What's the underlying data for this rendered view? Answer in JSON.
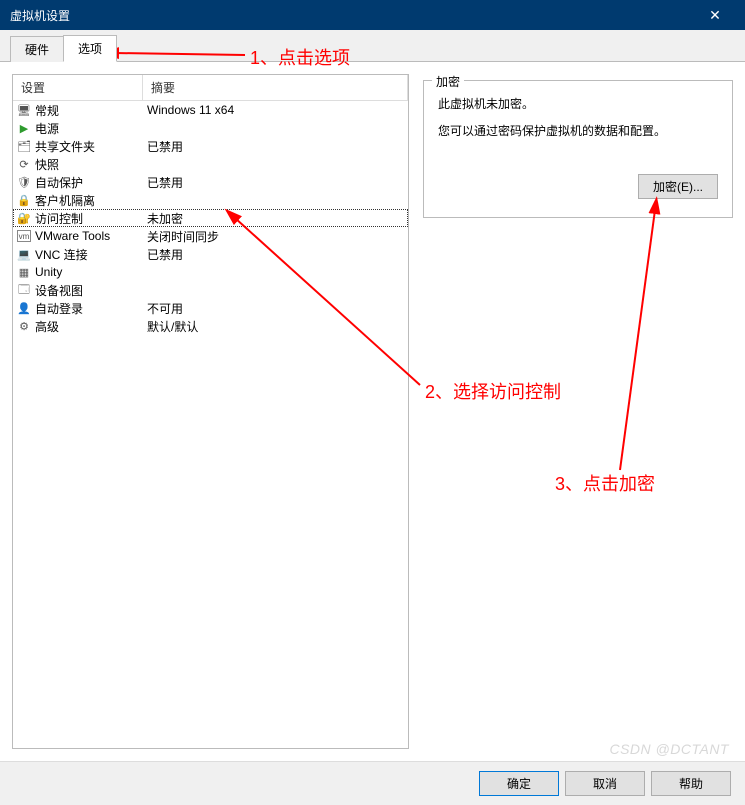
{
  "window": {
    "title": "虚拟机设置"
  },
  "tabs": {
    "hardware": "硬件",
    "options": "选项"
  },
  "list": {
    "header_setting": "设置",
    "header_summary": "摘要",
    "rows": [
      {
        "icon": "🖥",
        "label": "常规",
        "summary": "Windows 11 x64"
      },
      {
        "icon": "▶",
        "label": "电源",
        "summary": "",
        "icon_color": "#2e9b2e"
      },
      {
        "icon": "🗂",
        "label": "共享文件夹",
        "summary": "已禁用"
      },
      {
        "icon": "⟳",
        "label": "快照",
        "summary": ""
      },
      {
        "icon": "🛡",
        "label": "自动保护",
        "summary": "已禁用"
      },
      {
        "icon": "🔒",
        "label": "客户机隔离",
        "summary": ""
      },
      {
        "icon": "🔐",
        "label": "访问控制",
        "summary": "未加密",
        "selected": true
      },
      {
        "icon": "vm",
        "label": "VMware Tools",
        "summary": "关闭时间同步"
      },
      {
        "icon": "💻",
        "label": "VNC 连接",
        "summary": "已禁用"
      },
      {
        "icon": "▦",
        "label": "Unity",
        "summary": ""
      },
      {
        "icon": "🗔",
        "label": "设备视图",
        "summary": ""
      },
      {
        "icon": "👤",
        "label": "自动登录",
        "summary": "不可用"
      },
      {
        "icon": "⚙",
        "label": "高级",
        "summary": "默认/默认"
      }
    ]
  },
  "group": {
    "title": "加密",
    "line1": "此虚拟机未加密。",
    "line2": "您可以通过密码保护虚拟机的数据和配置。",
    "encrypt_button": "加密(E)..."
  },
  "buttons": {
    "ok": "确定",
    "cancel": "取消",
    "help": "帮助"
  },
  "annotations": {
    "a1": "1、点击选项",
    "a2": "2、选择访问控制",
    "a3": "3、点击加密"
  },
  "watermark": "CSDN @DCTANT"
}
